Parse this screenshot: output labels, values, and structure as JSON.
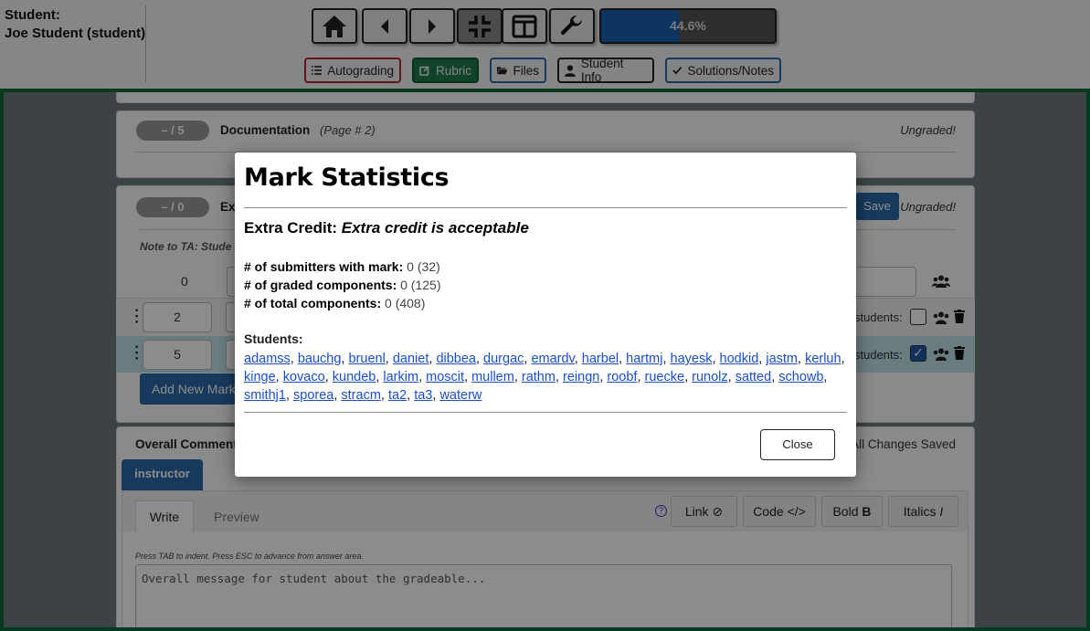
{
  "header": {
    "student_label": "Student:",
    "student_name": "Joe Student (student)",
    "progress_text": "44.6%",
    "progress_fraction": 0.446
  },
  "tabs": {
    "autograding": "Autograding",
    "rubric": "Rubric",
    "files": "Files",
    "student_info": "Student Info",
    "solutions": "Solutions/Notes"
  },
  "rubric": {
    "doc_pill": "– / 5",
    "doc_title": "Documentation",
    "doc_page": "(Page # 2)",
    "doc_status": "Ungraded!",
    "ec_pill": "– / 0",
    "ec_title_prefix": "Ext",
    "ec_status": "Ungraded!",
    "save_label": "Save",
    "note_prefix": "Note to TA: Stude",
    "points_value": "0",
    "mark1_points": "2",
    "mark2_points": "5",
    "students_label": "students:",
    "add_mark_label": "Add New Mark",
    "overall_label": "Overall Comment",
    "all_saved": "All Changes Saved",
    "author_tab": "instructor",
    "write_tab": "Write",
    "preview_tab": "Preview",
    "link_btn": "Link",
    "code_btn": "Code",
    "bold_btn": "Bold",
    "italics_btn": "Italics",
    "hint": "Press TAB to indent. Press ESC to advance from answer area.",
    "comment_placeholder": "Overall message for student about the gradeable..."
  },
  "modal": {
    "title": "Mark Statistics",
    "component_label": "Extra Credit:",
    "mark_title": "Extra credit is acceptable",
    "submitters_label": "# of submitters with mark:",
    "submitters_value": "0 (32)",
    "graded_label": "# of graded components:",
    "graded_value": "0 (125)",
    "total_label": "# of total components:",
    "total_value": "0 (408)",
    "students_label": "Students:",
    "students": [
      "adamss",
      "bauchg",
      "bruenl",
      "daniet",
      "dibbea",
      "durgac",
      "emardv",
      "harbel",
      "hartmj",
      "hayesk",
      "hodkid",
      "jastm",
      "kerluh",
      "kinge",
      "kovaco",
      "kundeb",
      "larkim",
      "moscit",
      "mullem",
      "rathm",
      "reingn",
      "roobf",
      "ruecke",
      "runolz",
      "satted",
      "schowb",
      "smithj1",
      "sporea",
      "stracm",
      "ta2",
      "ta3",
      "waterw"
    ],
    "close_label": "Close"
  },
  "colors": {
    "accent_green": "#0b6b3a",
    "progress_blue": "#1a5fb4",
    "autograding_border": "#b3263a",
    "rubric_bg": "#1e7a4c",
    "files_border": "#2a6aa8",
    "link_blue": "#1a4fc9"
  }
}
